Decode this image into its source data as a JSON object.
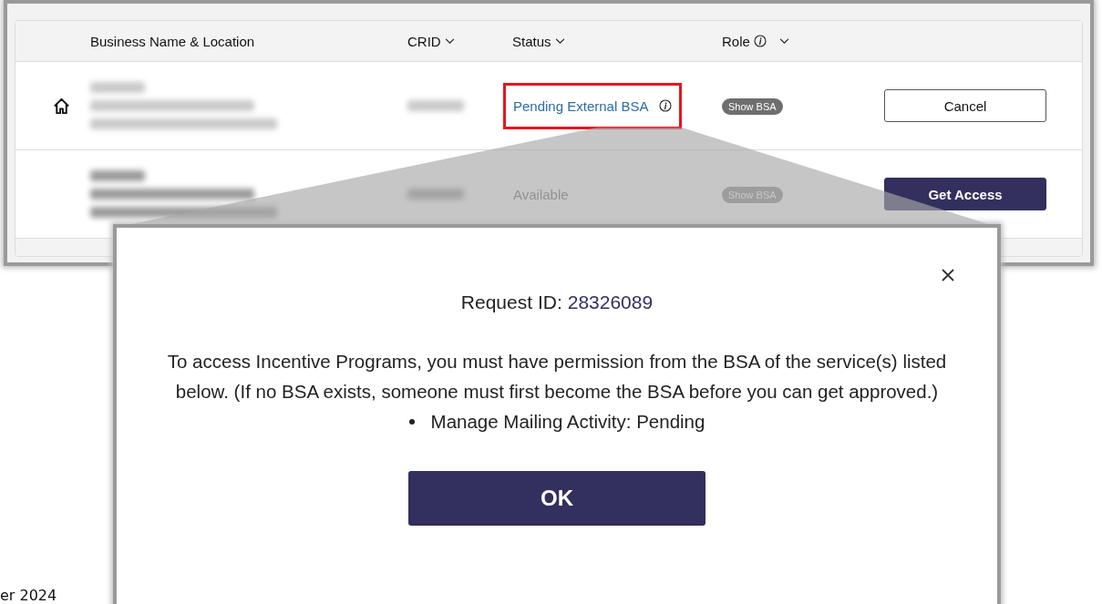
{
  "table": {
    "columns": [
      {
        "label": "Business Name & Location",
        "sortable": false,
        "info": false
      },
      {
        "label": "CRID",
        "sortable": true,
        "info": false
      },
      {
        "label": "Status",
        "sortable": true,
        "info": false
      },
      {
        "label": "Role",
        "sortable": true,
        "info": true
      }
    ],
    "rows": [
      {
        "home": true,
        "disabled": false,
        "highlighted": true,
        "status": "Pending External BSA",
        "status_info": true,
        "role_badge": "Show BSA",
        "action": {
          "label": "Cancel",
          "kind": "outline"
        }
      },
      {
        "home": false,
        "disabled": true,
        "highlighted": false,
        "status": "Available",
        "status_info": false,
        "role_badge": "Show BSA",
        "action": {
          "label": "Get Access",
          "kind": "primary"
        }
      }
    ]
  },
  "dialog": {
    "title": "Request ID:",
    "request_id": "28326089",
    "message": "To access Incentive Programs, you must have permission from the BSA of the service(s) listed below. (If no BSA exists, someone must first become the BSA before you can get approved.)",
    "items": [
      "Manage Mailing Activity: Pending"
    ],
    "button": "OK"
  },
  "footer": "er 2024"
}
